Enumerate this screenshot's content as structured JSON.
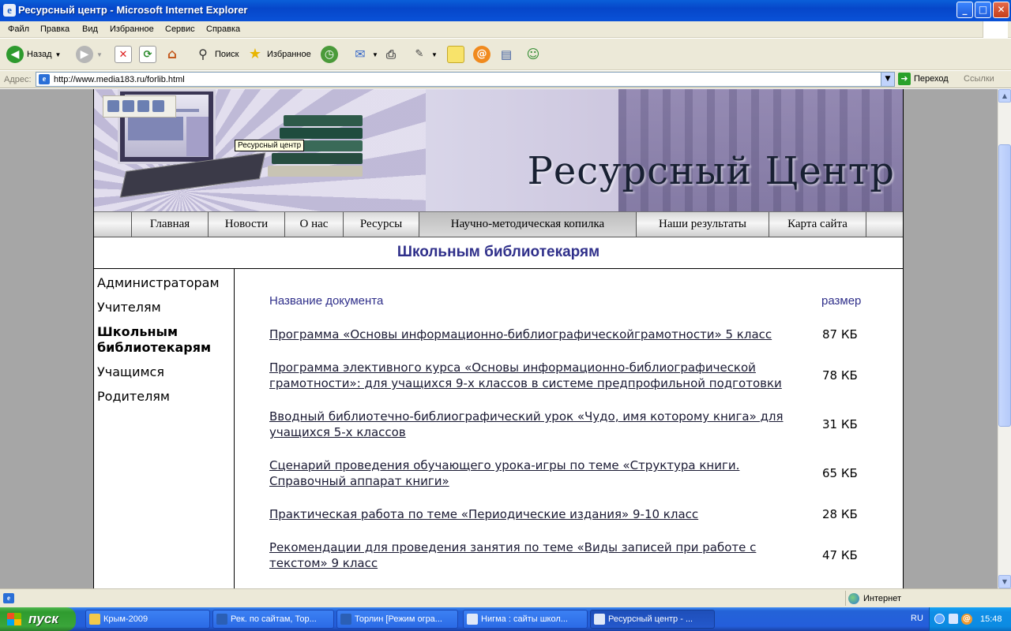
{
  "window": {
    "title": "Ресурсный центр - Microsoft Internet Explorer",
    "minimize": "_",
    "maximize": "□",
    "close": "✕"
  },
  "menu": [
    "Файл",
    "Правка",
    "Вид",
    "Избранное",
    "Сервис",
    "Справка"
  ],
  "toolbar": {
    "back_label": "Назад",
    "search_label": "Поиск",
    "favorites_label": "Избранное"
  },
  "address": {
    "label": "Адрес:",
    "url": "http://www.media183.ru/forlib.html",
    "go_label": "Переход",
    "links_label": "Ссылки"
  },
  "banner": {
    "brand": "Ресурсный Центр",
    "tooltip": "Ресурсный центр"
  },
  "nav": [
    "Главная",
    "Новости",
    "О нас",
    "Ресурсы",
    "Научно-методическая копилка",
    "Наши результаты",
    "Карта сайта"
  ],
  "section_title": "Школьным библиотекарям",
  "sidebar": [
    {
      "label": "Администраторам"
    },
    {
      "label": "Учителям"
    },
    {
      "label": "Школьным библиотекарям"
    },
    {
      "label": "Учащимся"
    },
    {
      "label": "Родителям"
    }
  ],
  "table": {
    "col_doc": "Название документа",
    "col_size": "размер",
    "rows": [
      {
        "title": "Программа «Основы информационно-библиографическойграмотности»  5 класс",
        "size": "87 КБ"
      },
      {
        "title": "Программа элективного курса «Основы информационно-библиографической грамотности»:  для учащихся 9-х классов в системе предпрофильной подготовки",
        "size": "78 КБ"
      },
      {
        "title": "Вводный библиотечно-библиографический урок «Чудо, имя которому книга» для учащихся 5-х классов",
        "size": "31 КБ"
      },
      {
        "title": "Сценарий проведения обучающего  урока-игры по теме «Структура книги. Справочный аппарат книги»",
        "size": "65 КБ"
      },
      {
        "title": "Практическая работа по теме «Периодические издания» 9-10 класс",
        "size": "28 КБ"
      },
      {
        "title": "Рекомендации для проведения занятия по теме «Виды записей при работе с текстом» 9 класс",
        "size": "47 КБ"
      }
    ]
  },
  "status": {
    "zone": "Интернет"
  },
  "taskbar": {
    "start": "пуск",
    "tasks": [
      "Крым-2009",
      "Рек. по сайтам, Тор...",
      "Торлин [Режим огра...",
      "Нигма : сайты школ...",
      "Ресурсный центр - ..."
    ],
    "lang": "RU",
    "clock": "15:48"
  }
}
